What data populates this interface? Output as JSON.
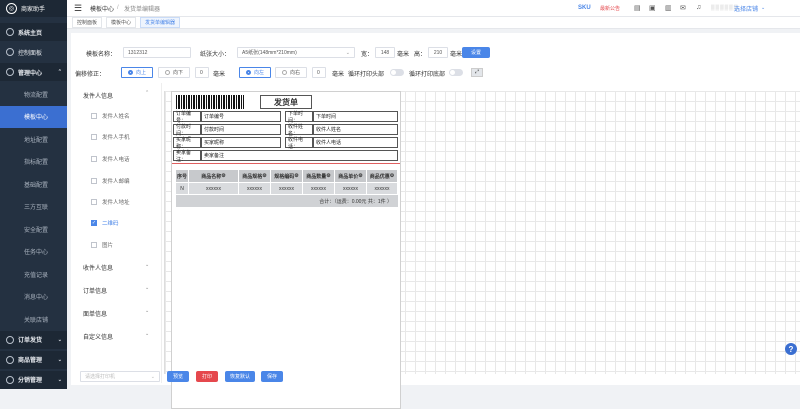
{
  "app": {
    "logo_text": "商家助手",
    "logo_mark": "◎"
  },
  "topbar": {
    "menu_icon": "menu-icon",
    "breadcrumb_root": "模板中心",
    "breadcrumb_sep": "/",
    "breadcrumb_current": "发货单编辑器",
    "sku": "SKU",
    "badge": "最新公告",
    "user": "选择店铺"
  },
  "tabs": [
    {
      "label": "控制面板"
    },
    {
      "label": "模板中心"
    },
    {
      "label": "发货单编辑器"
    }
  ],
  "sidebar": {
    "items": [
      {
        "label": "系统主页",
        "icon": "home-icon",
        "type": "head"
      },
      {
        "label": "控制面板",
        "icon": "dashboard-icon",
        "type": "plain"
      },
      {
        "label": "管理中心",
        "icon": "gear-icon",
        "type": "head",
        "chev": "⌃"
      },
      {
        "label": "物流配置",
        "type": "sub"
      },
      {
        "label": "模板中心",
        "type": "sub",
        "active": true
      },
      {
        "label": "地址配置",
        "type": "sub"
      },
      {
        "label": "指标配置",
        "type": "sub"
      },
      {
        "label": "基础配置",
        "type": "sub"
      },
      {
        "label": "三方互联",
        "type": "sub"
      },
      {
        "label": "安全配置",
        "type": "sub"
      },
      {
        "label": "任务中心",
        "type": "sub"
      },
      {
        "label": "充值记录",
        "type": "sub"
      },
      {
        "label": "消息中心",
        "type": "sub"
      },
      {
        "label": "关联店铺",
        "type": "sub"
      },
      {
        "label": "订单发货",
        "icon": "order-icon",
        "type": "head",
        "chev": "⌄"
      },
      {
        "label": "商品管理",
        "icon": "goods-icon",
        "type": "head",
        "chev": "⌄"
      },
      {
        "label": "分销管理",
        "icon": "share-icon",
        "type": "head",
        "chev": "⌄"
      }
    ]
  },
  "form": {
    "name_label": "模板名称：",
    "name_value": "1312312",
    "size_label": "纸张大小：",
    "size_value": "A5纸张(148mm*210mm)",
    "width_label": "宽：",
    "width_value": "148",
    "unit": "毫米",
    "height_label": "高：",
    "height_value": "210",
    "set_button": "设置",
    "offset_label": "偏移修正：",
    "up": "向上",
    "down": "向下",
    "v_value": "0",
    "left": "向左",
    "right": "向右",
    "h_value": "0",
    "loop_header": "循环打印头部",
    "loop_footer": "循环打印底部"
  },
  "panel": {
    "sections": [
      {
        "label": "发件人信息",
        "chev": "⌃"
      },
      {
        "label": "收件人信息",
        "chev": "⌄"
      },
      {
        "label": "订单信息",
        "chev": "⌄"
      },
      {
        "label": "面单信息",
        "chev": "⌄"
      },
      {
        "label": "自定义信息",
        "chev": "⌄"
      }
    ],
    "fields": [
      {
        "label": "发件人姓名",
        "checked": false
      },
      {
        "label": "发件人手机",
        "checked": false
      },
      {
        "label": "发件人电话",
        "checked": false
      },
      {
        "label": "发件人邮编",
        "checked": false
      },
      {
        "label": "发件人地址",
        "checked": false
      },
      {
        "label": "二维码",
        "checked": true
      },
      {
        "label": "图片",
        "checked": false
      }
    ]
  },
  "invoice": {
    "title": "发货单",
    "rows": [
      [
        "订单编号：",
        "订单编号",
        "下单时间：",
        "下单时间"
      ],
      [
        "付款时间：",
        "付款时间",
        "收件姓名：",
        "收件人姓名"
      ],
      [
        "买家昵称：",
        "买家昵称",
        "收件电话：",
        "收件人电话"
      ],
      [
        "卖家备注：",
        "卖家备注",
        "",
        ""
      ]
    ],
    "headers": [
      "序号",
      "商品名称",
      "商品规格",
      "规格编码",
      "商品数量",
      "商品单价",
      "商品优惠"
    ],
    "row": [
      "N",
      "xxxxxx",
      "xxxxxx",
      "xxxxxx",
      "xxxxxx",
      "xxxxxx",
      "xxxxxx"
    ],
    "total": "合计：（运费：0.00元 共：1件 ）"
  },
  "footer": {
    "printer_placeholder": "请选择打印机",
    "preview": "预览",
    "print": "打印",
    "reset": "恢复默认",
    "save": "保存"
  },
  "colors": {
    "primary": "#4a86e8",
    "danger": "#e5484d",
    "sidebar": "#243141"
  }
}
